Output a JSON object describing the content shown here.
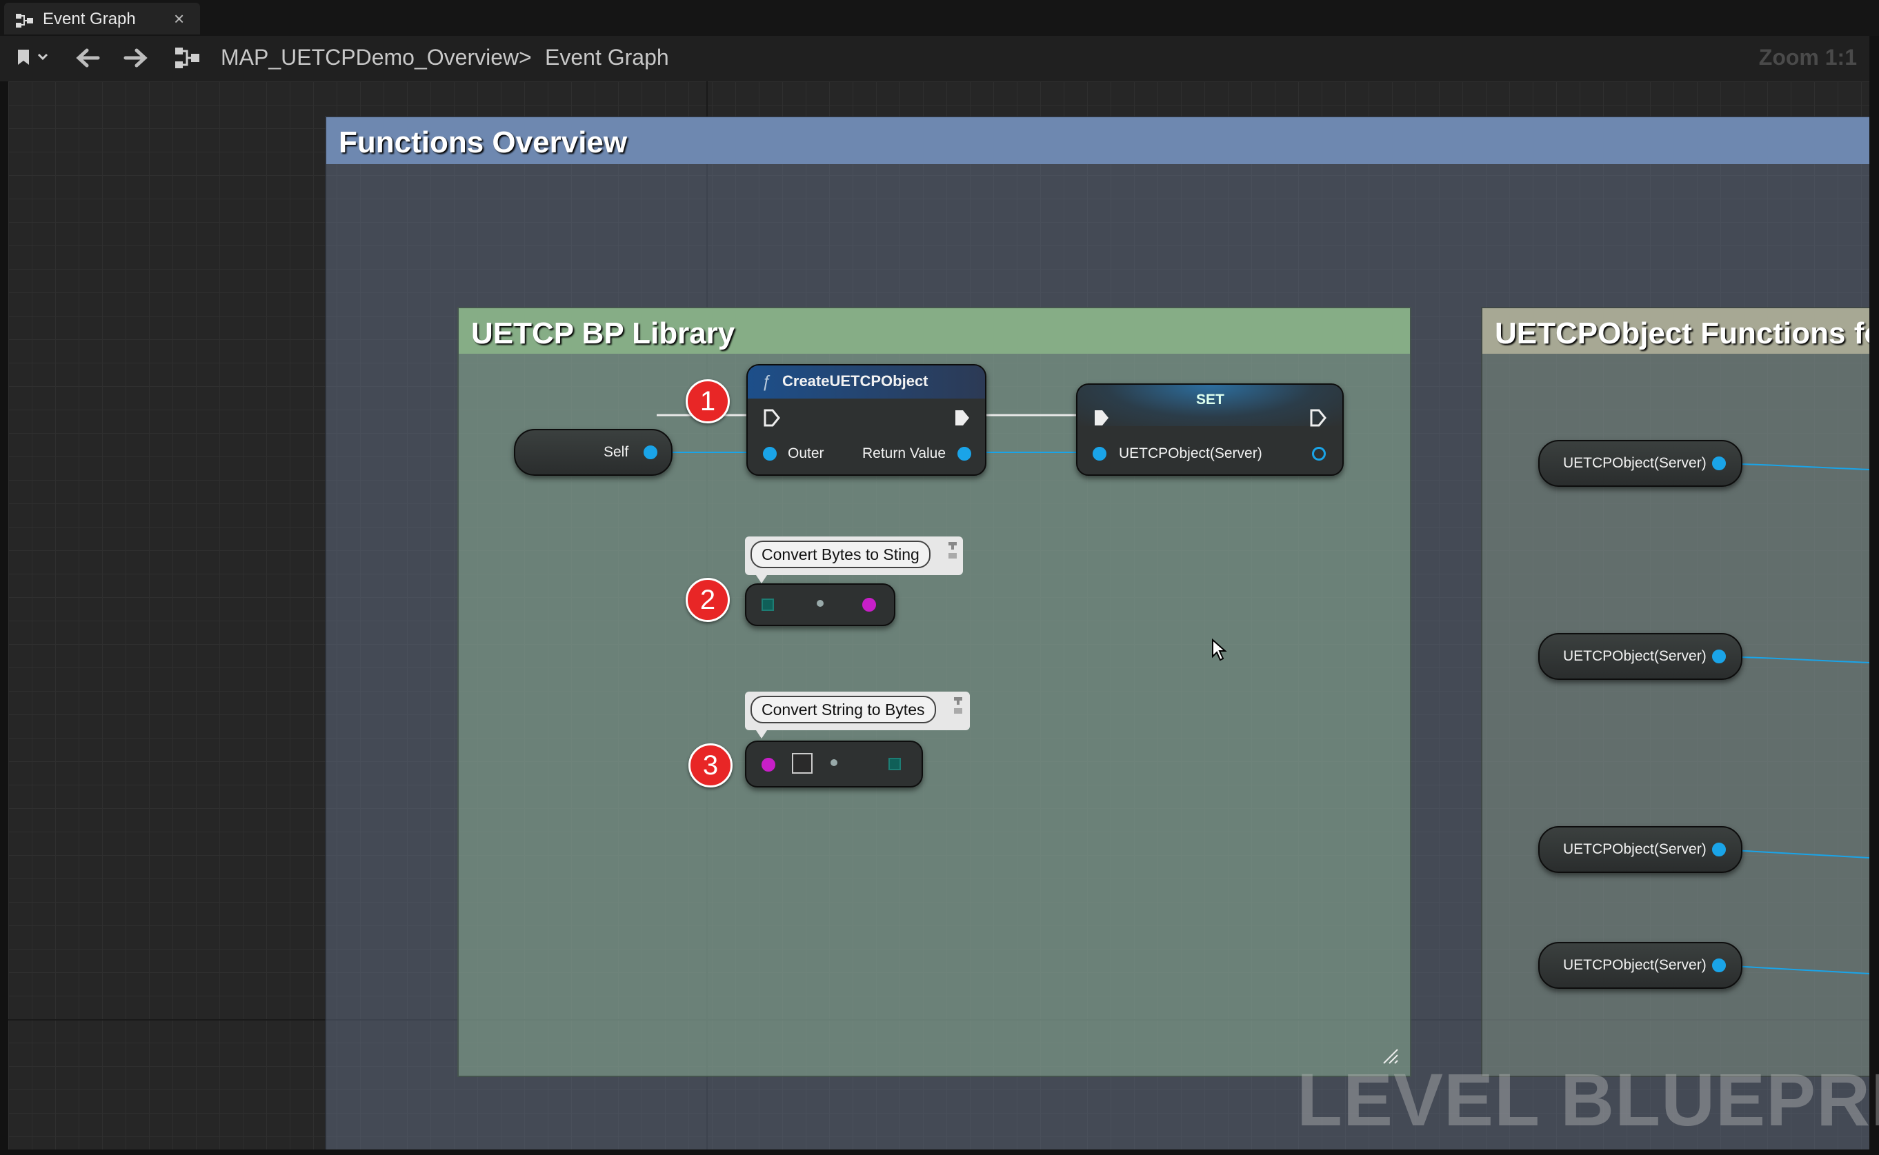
{
  "tab": {
    "title": "Event Graph",
    "close_label": "×",
    "icon": "graph-icon"
  },
  "toolbar": {
    "breadcrumb": [
      "MAP_UETCPDemo_Overview",
      "Event Graph"
    ],
    "separator": ">",
    "zoom": "Zoom 1:1",
    "icons": [
      "bookmark-icon",
      "back-arrow-icon",
      "forward-arrow-icon",
      "graph-icon"
    ]
  },
  "comments": {
    "outer": {
      "title": "Functions Overview",
      "color": "#6e88b0"
    },
    "library": {
      "title": "UETCP BP Library",
      "color": "#86ad86"
    },
    "object_functions": {
      "title": "UETCPObject Functions for S",
      "color": "#a7a894"
    }
  },
  "nodes": {
    "self": {
      "label": "Self"
    },
    "create": {
      "title": "CreateUETCPObject",
      "func_glyph": "ƒ",
      "pin_outer": "Outer",
      "pin_return": "Return Value"
    },
    "set": {
      "title": "SET",
      "pin_var": "UETCPObject(Server)"
    },
    "convert_bytes": {
      "bubble": "Convert Bytes to Sting"
    },
    "convert_string": {
      "bubble": "Convert String to Bytes"
    },
    "server_vars": [
      "UETCPObject(Server)",
      "UETCPObject(Server)",
      "UETCPObject(Server)",
      "UETCPObject(Server)"
    ]
  },
  "badges": [
    "1",
    "2",
    "3"
  ],
  "watermark": "LEVEL BLUEPRINT",
  "colors": {
    "object_pin": "#1aa4e8",
    "byte_array_pin": "#c81fc8",
    "badge": "#e82626"
  }
}
